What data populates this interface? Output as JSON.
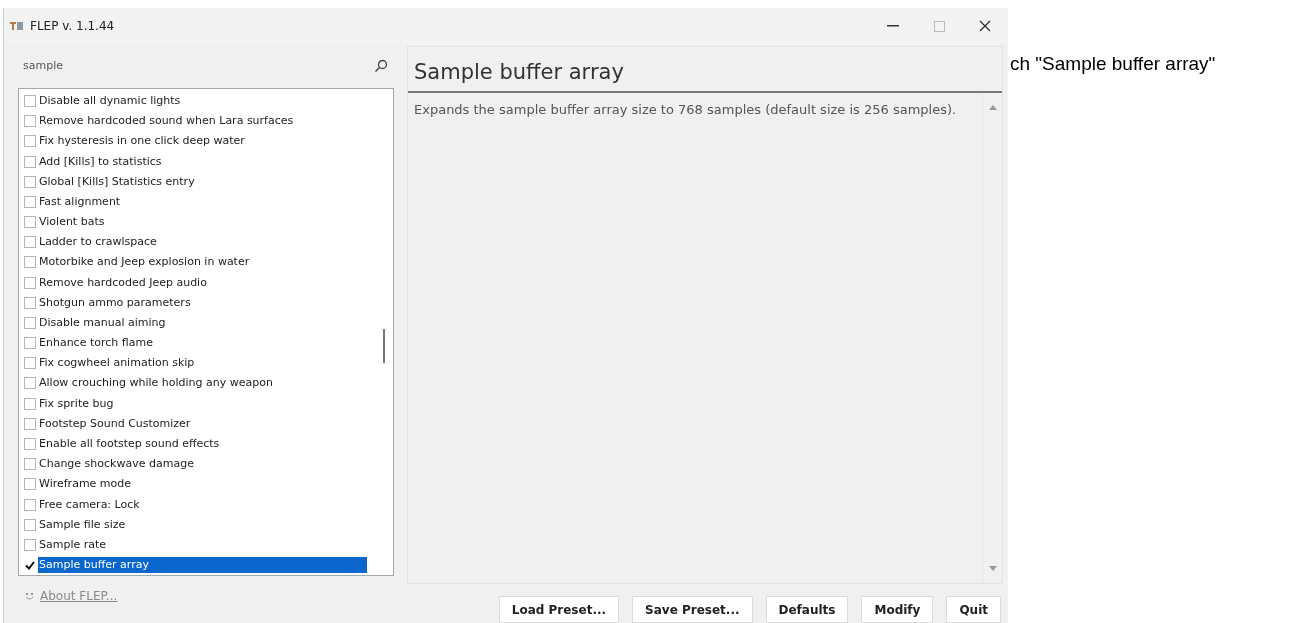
{
  "window": {
    "title": "FLEP v. 1.1.44"
  },
  "search": {
    "value": "sample"
  },
  "options": [
    {
      "label": "Disable all dynamic lights",
      "checked": false,
      "selected": false
    },
    {
      "label": "Remove hardcoded sound when Lara surfaces",
      "checked": false,
      "selected": false
    },
    {
      "label": "Fix hysteresis in one click deep water",
      "checked": false,
      "selected": false
    },
    {
      "label": "Add [Kills] to statistics",
      "checked": false,
      "selected": false
    },
    {
      "label": "Global [Kills] Statistics entry",
      "checked": false,
      "selected": false
    },
    {
      "label": "Fast alignment",
      "checked": false,
      "selected": false
    },
    {
      "label": "Violent bats",
      "checked": false,
      "selected": false
    },
    {
      "label": "Ladder to crawlspace",
      "checked": false,
      "selected": false
    },
    {
      "label": "Motorbike and Jeep explosion in water",
      "checked": false,
      "selected": false
    },
    {
      "label": "Remove hardcoded Jeep audio",
      "checked": false,
      "selected": false
    },
    {
      "label": "Shotgun ammo parameters",
      "checked": false,
      "selected": false
    },
    {
      "label": "Disable manual aiming",
      "checked": false,
      "selected": false
    },
    {
      "label": "Enhance torch flame",
      "checked": false,
      "selected": false
    },
    {
      "label": "Fix cogwheel animation skip",
      "checked": false,
      "selected": false
    },
    {
      "label": "Allow crouching while holding any weapon",
      "checked": false,
      "selected": false
    },
    {
      "label": "Fix sprite bug",
      "checked": false,
      "selected": false
    },
    {
      "label": "Footstep Sound Customizer",
      "checked": false,
      "selected": false
    },
    {
      "label": "Enable all footstep sound effects",
      "checked": false,
      "selected": false
    },
    {
      "label": "Change shockwave damage",
      "checked": false,
      "selected": false
    },
    {
      "label": "Wireframe mode",
      "checked": false,
      "selected": false
    },
    {
      "label": "Free camera: Lock",
      "checked": false,
      "selected": false
    },
    {
      "label": "Sample file size",
      "checked": false,
      "selected": false
    },
    {
      "label": "Sample rate",
      "checked": false,
      "selected": false
    },
    {
      "label": "Sample buffer array",
      "checked": true,
      "selected": true
    }
  ],
  "detail": {
    "title": "Sample buffer array",
    "description": "Expands the sample buffer array size to 768 samples (default size is 256 samples)."
  },
  "about_link": "About FLEP...",
  "buttons": [
    "Load Preset...",
    "Save Preset...",
    "Defaults",
    "Modify",
    "Quit"
  ],
  "page_text": "ch \"Sample buffer array\""
}
